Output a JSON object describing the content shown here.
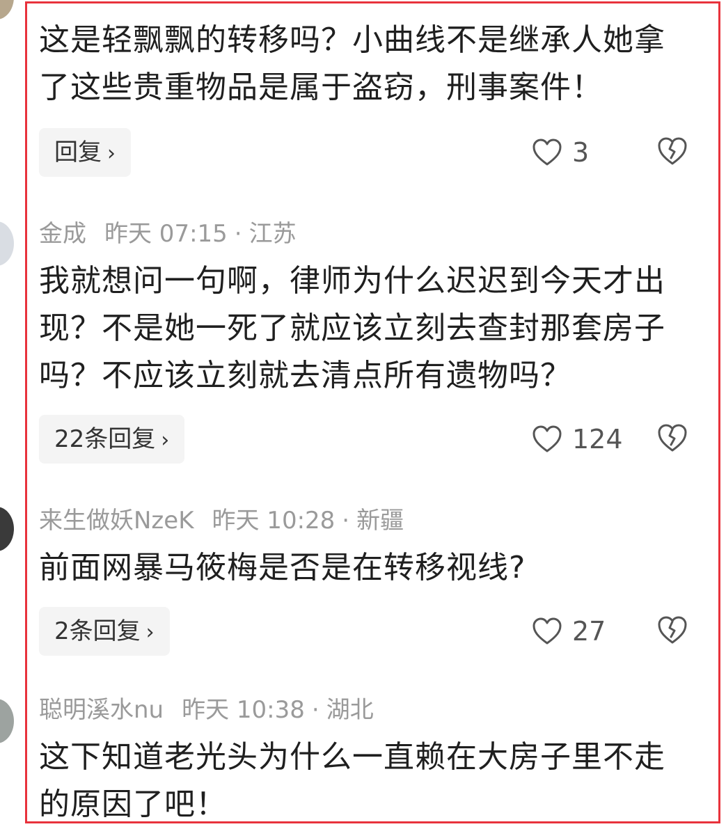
{
  "comments": [
    {
      "content": "这是轻飘飘的转移吗？小曲线不是继承人她拿了这些贵重物品是属于盗窃，刑事案件！",
      "reply_label": "回复",
      "likes": "3"
    },
    {
      "author": "金成",
      "time": "昨天 07:15",
      "location": "江苏",
      "content": "我就想问一句啊，律师为什么迟迟到今天才出现？不是她一死了就应该立刻去查封那套房子吗？不应该立刻就去清点所有遗物吗？",
      "reply_label": "22条回复",
      "likes": "124"
    },
    {
      "author": "来生做妖NzeK",
      "time": "昨天 10:28",
      "location": "新疆",
      "content": "前面网暴马筱梅是否是在转移视线?",
      "reply_label": "2条回复",
      "likes": "27"
    },
    {
      "author": "聪明溪水nu",
      "time": "昨天 10:38",
      "location": "湖北",
      "content": "这下知道老光头为什么一直赖在大房子里不走的原因了吧！"
    }
  ],
  "icons": {
    "like": "heart-outline-icon",
    "dislike": "broken-heart-icon",
    "chevron": "chevron-right-icon"
  },
  "colors": {
    "highlight": "#e8323c",
    "meta_text": "#9a9a9a",
    "reply_bg": "#f4f4f4"
  }
}
